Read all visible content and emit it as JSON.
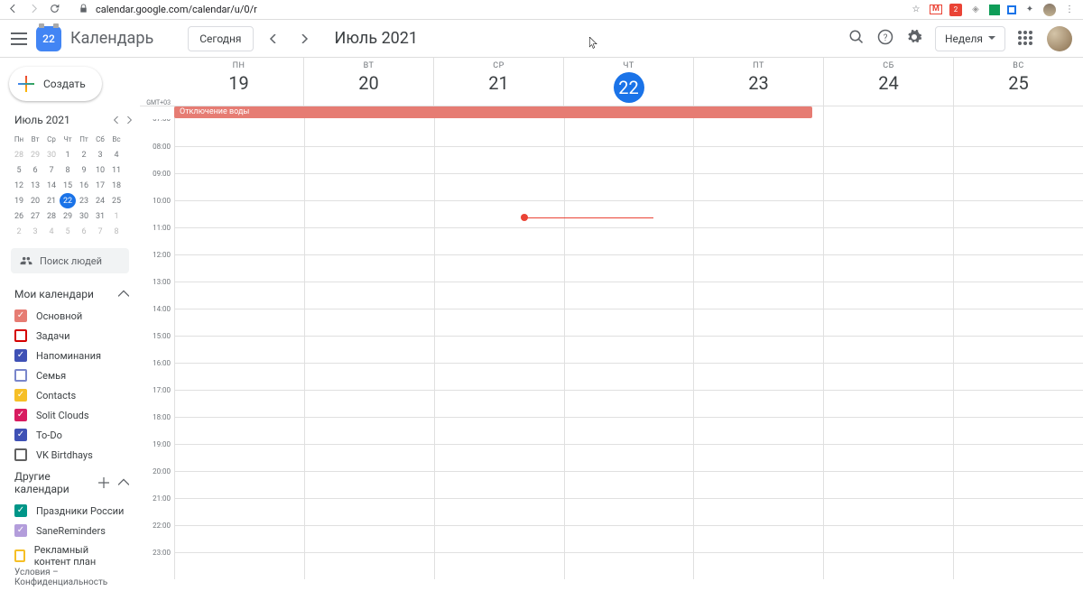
{
  "browser": {
    "url": "calendar.google.com/calendar/u/0/r"
  },
  "header": {
    "logo_day": "22",
    "app_name": "Календарь",
    "today_label": "Сегодня",
    "period": "Июль 2021",
    "view_label": "Неделя"
  },
  "create_label": "Создать",
  "mini": {
    "title": "Июль 2021",
    "dow": [
      "Пн",
      "Вт",
      "Ср",
      "Чт",
      "Пт",
      "Сб",
      "Вс"
    ],
    "weeks": [
      [
        {
          "d": "28",
          "o": true
        },
        {
          "d": "29",
          "o": true
        },
        {
          "d": "30",
          "o": true
        },
        {
          "d": "1"
        },
        {
          "d": "2"
        },
        {
          "d": "3"
        },
        {
          "d": "4"
        }
      ],
      [
        {
          "d": "5"
        },
        {
          "d": "6"
        },
        {
          "d": "7"
        },
        {
          "d": "8"
        },
        {
          "d": "9"
        },
        {
          "d": "10"
        },
        {
          "d": "11"
        }
      ],
      [
        {
          "d": "12"
        },
        {
          "d": "13"
        },
        {
          "d": "14"
        },
        {
          "d": "15"
        },
        {
          "d": "16"
        },
        {
          "d": "17"
        },
        {
          "d": "18"
        }
      ],
      [
        {
          "d": "19"
        },
        {
          "d": "20"
        },
        {
          "d": "21"
        },
        {
          "d": "22",
          "t": true
        },
        {
          "d": "23"
        },
        {
          "d": "24"
        },
        {
          "d": "25"
        }
      ],
      [
        {
          "d": "26"
        },
        {
          "d": "27"
        },
        {
          "d": "28"
        },
        {
          "d": "29"
        },
        {
          "d": "30"
        },
        {
          "d": "31"
        },
        {
          "d": "1",
          "o": true
        }
      ],
      [
        {
          "d": "2",
          "o": true
        },
        {
          "d": "3",
          "o": true
        },
        {
          "d": "4",
          "o": true
        },
        {
          "d": "5",
          "o": true
        },
        {
          "d": "6",
          "o": true
        },
        {
          "d": "7",
          "o": true
        },
        {
          "d": "8",
          "o": true
        }
      ]
    ]
  },
  "search_people": "Поиск людей",
  "my_calendars_label": "Мои календари",
  "other_calendars_label": "Другие календари",
  "my_calendars": [
    {
      "label": "Основной",
      "color": "#e67c73",
      "checked": true
    },
    {
      "label": "Задачи",
      "color": "#d50000",
      "checked": false
    },
    {
      "label": "Напоминания",
      "color": "#3f51b5",
      "checked": true
    },
    {
      "label": "Семья",
      "color": "#7986cb",
      "checked": false
    },
    {
      "label": "Contacts",
      "color": "#f6bf26",
      "checked": true
    },
    {
      "label": "Solit Clouds",
      "color": "#d81b60",
      "checked": true
    },
    {
      "label": "To-Do",
      "color": "#3f51b5",
      "checked": true
    },
    {
      "label": "VK Birtdhays",
      "color": "#616161",
      "checked": false
    }
  ],
  "other_calendars": [
    {
      "label": "Праздники России",
      "color": "#009688",
      "checked": true
    },
    {
      "label": "SaneReminders",
      "color": "#b39ddb",
      "checked": true
    },
    {
      "label": "Рекламный контент план",
      "color": "#f6bf26",
      "checked": false
    }
  ],
  "footer": "Условия – Конфиденциальность",
  "timezone": "GMT+03",
  "days": [
    {
      "dow": "ПН",
      "num": "19"
    },
    {
      "dow": "ВТ",
      "num": "20"
    },
    {
      "dow": "СР",
      "num": "21"
    },
    {
      "dow": "ЧТ",
      "num": "22",
      "today": true
    },
    {
      "dow": "ПТ",
      "num": "23"
    },
    {
      "dow": "СБ",
      "num": "24"
    },
    {
      "dow": "ВС",
      "num": "25"
    }
  ],
  "allday_event": {
    "title": "Отключение воды",
    "start_col": 0,
    "span": 5,
    "color": "#e67c73"
  },
  "hours": [
    "07:00",
    "08:00",
    "09:00",
    "10:00",
    "11:00",
    "12:00",
    "13:00",
    "14:00",
    "15:00",
    "16:00",
    "17:00",
    "18:00",
    "19:00",
    "20:00",
    "21:00",
    "22:00",
    "23:00"
  ],
  "now": {
    "col": 3,
    "hour_index": 3,
    "fraction": 0.62
  }
}
